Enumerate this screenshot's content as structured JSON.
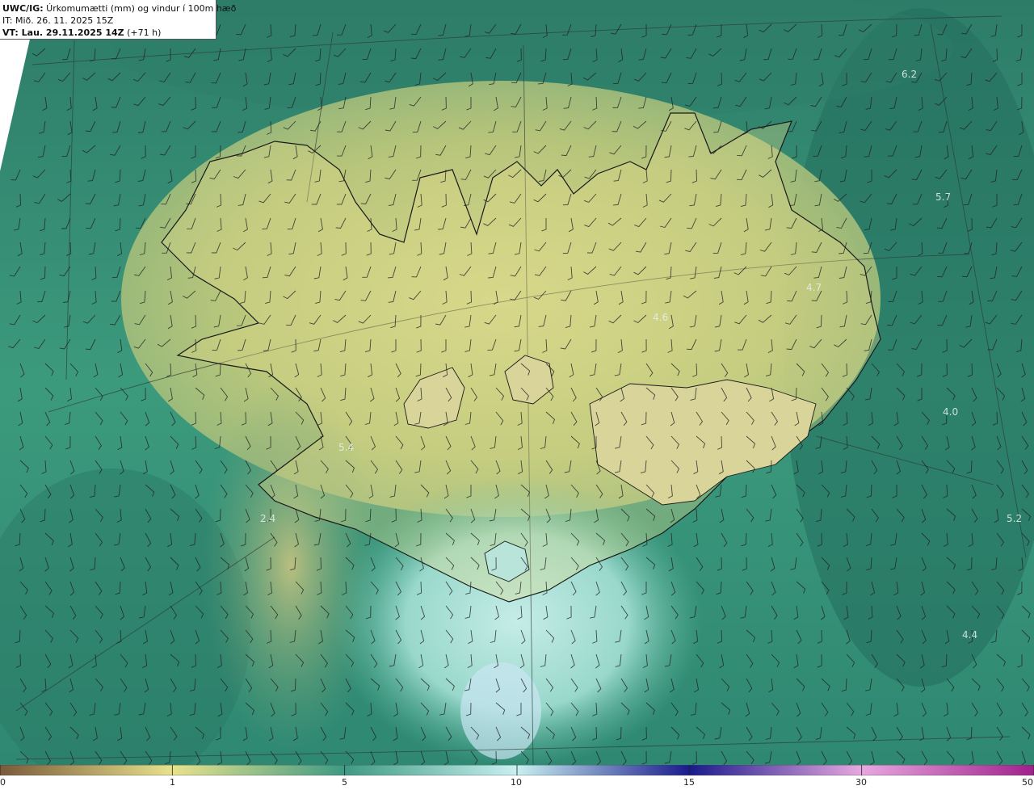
{
  "header": {
    "product": "UWC/IG:",
    "title": " Úrkomumætti (mm) og vindur í 100m hæð",
    "init_time": "IT: Mið. 26. 11. 2025 15Z",
    "valid_label": "VT: Lau. 29.11.2025 14Z",
    "lead_time": " (+71 h)"
  },
  "map_labels": [
    {
      "text": "6.2"
    },
    {
      "text": "5.7"
    },
    {
      "text": "4.7"
    },
    {
      "text": "4.6"
    },
    {
      "text": "4.0"
    },
    {
      "text": "5.4"
    },
    {
      "text": "5.2"
    },
    {
      "text": "2.4"
    },
    {
      "text": "4.4"
    }
  ],
  "colorbar": {
    "ticks": [
      "0",
      "1",
      "5",
      "10",
      "15",
      "30",
      "50"
    ],
    "colors": [
      "#7a5a3a",
      "#e8e28c",
      "#3f9a84",
      "#c8f0f0",
      "#1a1a8c",
      "#e8a8e0",
      "#a0208c"
    ]
  },
  "colors": {
    "land_low": "#e8e08e",
    "sea_mid": "#3e9070",
    "sea_dark": "#1f6a5a",
    "coastline": "#1a1a1a",
    "wind_barb": "#222222"
  }
}
